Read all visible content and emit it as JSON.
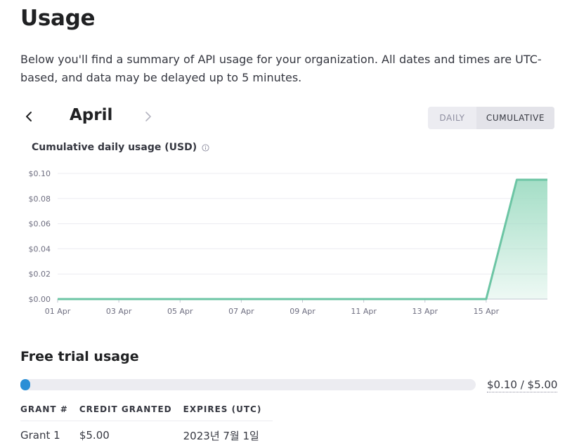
{
  "page": {
    "title": "Usage",
    "description": "Below you'll find a summary of API usage for your organization. All dates and times are UTC-based, and data may be delayed up to 5 minutes."
  },
  "month_nav": {
    "month": "April",
    "prev_icon": "chevron-left-icon",
    "next_icon": "chevron-right-icon"
  },
  "view_toggle": {
    "daily_label": "DAILY",
    "cumulative_label": "CUMULATIVE",
    "selected": "CUMULATIVE"
  },
  "chart_data": {
    "type": "area",
    "title": "Cumulative daily usage (USD)",
    "xlabel": "",
    "ylabel": "",
    "x_tick_labels": [
      "01 Apr",
      "03 Apr",
      "05 Apr",
      "07 Apr",
      "09 Apr",
      "11 Apr",
      "13 Apr",
      "15 Apr"
    ],
    "y_tick_labels": [
      "$0.00",
      "$0.02",
      "$0.04",
      "$0.06",
      "$0.08",
      "$0.10"
    ],
    "ylim": [
      0,
      0.1
    ],
    "grid": true,
    "line_color": "#6cc5a4",
    "fill_color": "#9fdcc3",
    "series": [
      {
        "x": [
          "01 Apr",
          "02 Apr",
          "03 Apr",
          "04 Apr",
          "05 Apr",
          "06 Apr",
          "07 Apr",
          "08 Apr",
          "09 Apr",
          "10 Apr",
          "11 Apr",
          "12 Apr",
          "13 Apr",
          "14 Apr",
          "15 Apr",
          "16 Apr",
          "17 Apr"
        ],
        "values": [
          0,
          0,
          0,
          0,
          0,
          0,
          0,
          0,
          0,
          0,
          0,
          0,
          0,
          0,
          0,
          0.095,
          0.095
        ]
      }
    ]
  },
  "free_trial": {
    "title": "Free trial usage",
    "used_fraction": 0.02,
    "progress_text": "$0.10 / $5.00",
    "bar_color": "#2b8fd6",
    "info_icon": "info-icon",
    "table": {
      "headers": [
        "GRANT #",
        "CREDIT GRANTED",
        "EXPIRES (UTC)"
      ],
      "rows": [
        [
          "Grant 1",
          "$5.00",
          "2023년 7월 1일"
        ]
      ]
    }
  }
}
